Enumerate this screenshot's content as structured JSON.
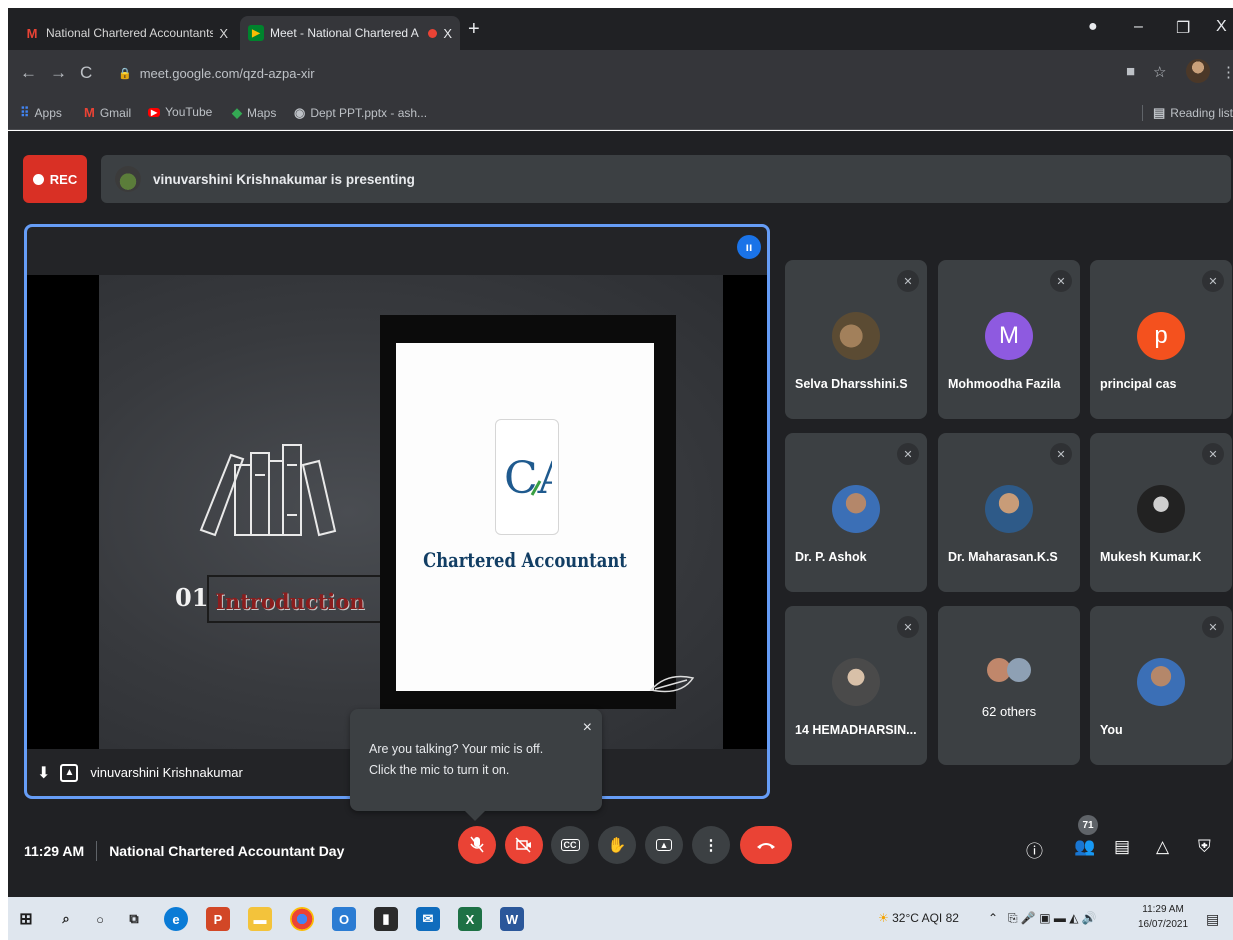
{
  "browser": {
    "tabs": [
      {
        "title": "National Chartered Accountants",
        "favicon": "gmail-icon",
        "active": false
      },
      {
        "title": "Meet - National Chartered A",
        "favicon": "meet-icon",
        "active": true,
        "recording": true
      }
    ],
    "new_tab": "+",
    "address": "meet.google.com/qzd-azpa-xir",
    "bookmarks": [
      "Apps",
      "Gmail",
      "YouTube",
      "Maps",
      "Dept PPT.pptx - ash..."
    ],
    "reading_list": "Reading list"
  },
  "meet": {
    "rec_label": "REC",
    "presenting_text": "vinuvarshini Krishnakumar is presenting",
    "presenter_name": "vinuvarshini Krishnakumar",
    "slide": {
      "number": "01",
      "heading": "Introduction",
      "logo_text": "CA",
      "title": "Chartered Accountant"
    },
    "tooltip": {
      "line1": "Are you talking? Your mic is off.",
      "line2": "Click the mic to turn it on."
    },
    "participants": [
      {
        "name": "Selva Dharsshini.S",
        "avatar": "photo",
        "letter": ""
      },
      {
        "name": "Mohmoodha Fazila",
        "avatar": "letter",
        "letter": "M",
        "color": "#8e5ae0"
      },
      {
        "name": "principal cas",
        "avatar": "letter",
        "letter": "p",
        "color": "#f4511e"
      },
      {
        "name": "Dr. P. Ashok",
        "avatar": "photo",
        "letter": ""
      },
      {
        "name": "Dr. Maharasan.K.S",
        "avatar": "photo",
        "letter": ""
      },
      {
        "name": "Mukesh Kumar.K",
        "avatar": "photo",
        "letter": ""
      },
      {
        "name": "14 HEMADHARSIN...",
        "avatar": "photo",
        "letter": ""
      },
      {
        "name": "62 others",
        "avatar": "group",
        "letter": ""
      },
      {
        "name": "You",
        "avatar": "photo",
        "letter": ""
      }
    ],
    "time": "11:29 AM",
    "meeting_title": "National Chartered Accountant Day",
    "participant_count": "71"
  },
  "taskbar": {
    "weather": "32°C AQI 82",
    "time": "11:29 AM",
    "date": "16/07/2021"
  }
}
